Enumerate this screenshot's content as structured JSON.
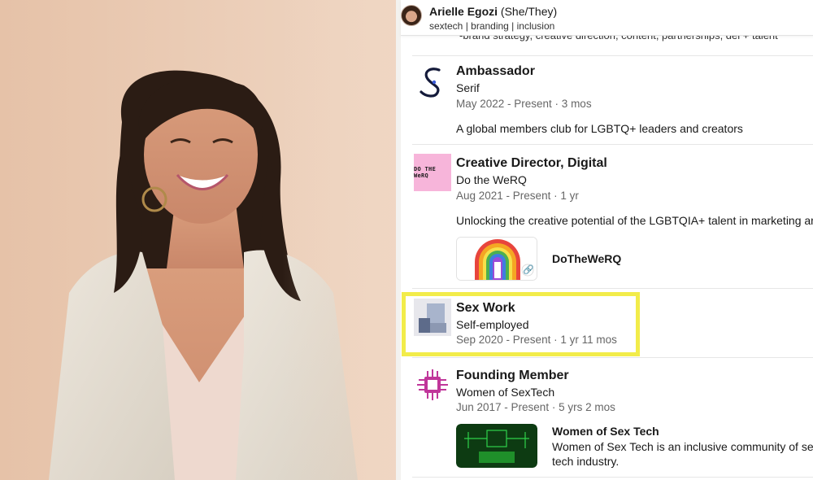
{
  "profile": {
    "name": "Arielle Egozi",
    "pronouns": "(She/They)",
    "headline": "sextech | branding | inclusion"
  },
  "cutoff_text": "-brand strategy, creative direction, content, partnerships, dei + talent",
  "experience": [
    {
      "title": "Ambassador",
      "company": "Serif",
      "dates": "May 2022 - Present · 3 mos",
      "description": "A global members club for LGBTQ+ leaders and creators",
      "logo_icon": "serif-s-logo-icon"
    },
    {
      "title": "Creative Director, Digital",
      "company": "Do the WeRQ",
      "dates": "Aug 2021 - Present · 1 yr",
      "description": "Unlocking the creative potential of the LGBTQIA+ talent in marketing and",
      "logo_text": "DO THE WeRQ",
      "media": {
        "label": "DoTheWeRQ"
      }
    },
    {
      "title": "Sex Work",
      "company": "Self-employed",
      "dates": "Sep 2020 - Present · 1 yr 11 mos",
      "highlighted": true
    },
    {
      "title": "Founding Member",
      "company": "Women of SexTech",
      "dates": "Jun 2017 - Present · 5 yrs 2 mos",
      "media": {
        "label": "Women of Sex Tech",
        "subtext_line1": "Women of Sex Tech is an inclusive community of sex-p",
        "subtext_line2": "tech industry."
      }
    }
  ],
  "colors": {
    "highlight": "#f2ec4a",
    "werq_pink": "#f7b5da",
    "wost_magenta": "#c0369a",
    "wost_green": "#1f8f2a"
  }
}
